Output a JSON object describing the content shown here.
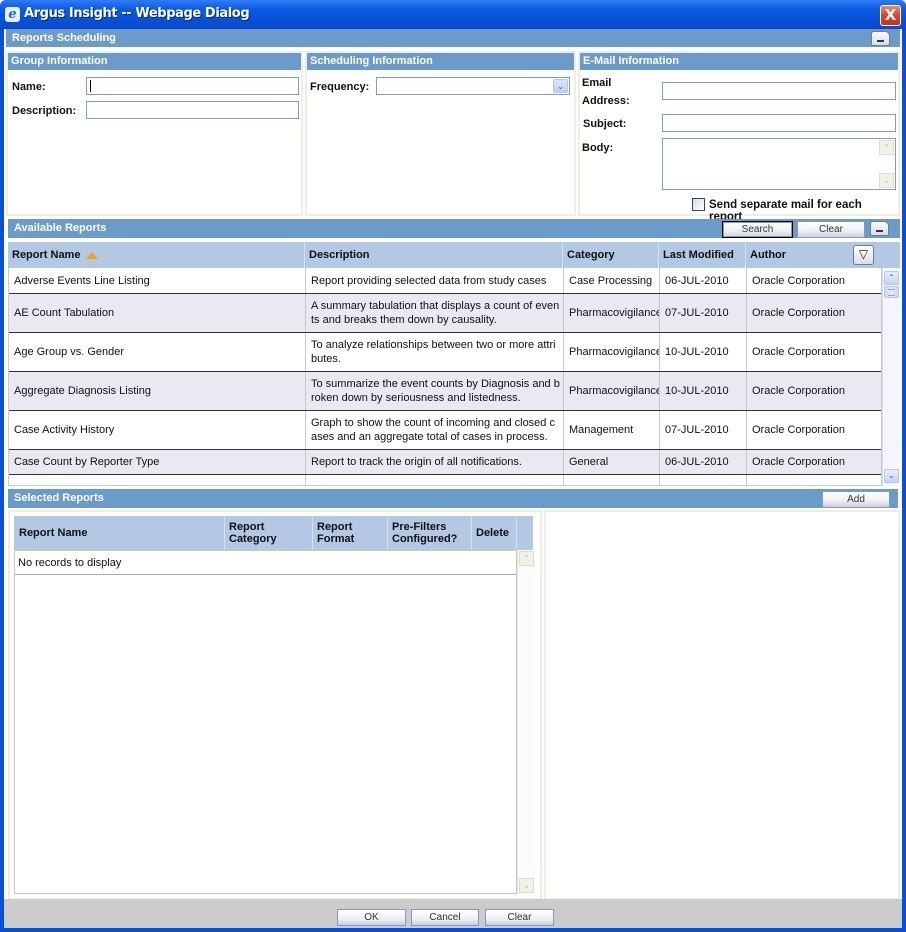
{
  "window": {
    "title": "Argus Insight -- Webpage Dialog",
    "close_icon": "X"
  },
  "header": {
    "title": "Reports Scheduling"
  },
  "group_info": {
    "title": "Group Information",
    "name_label": "Name:",
    "name_value": "",
    "description_label": "Description:",
    "description_value": ""
  },
  "scheduling_info": {
    "title": "Scheduling Information",
    "frequency_label": "Frequency:",
    "frequency_value": "",
    "dropdown_icon": "⌄"
  },
  "email_info": {
    "title": "E-Mail Information",
    "email_label_line1": "Email",
    "email_label_line2": "Address:",
    "email_value": "",
    "subject_label": "Subject:",
    "subject_value": "",
    "body_label": "Body:",
    "body_value": "",
    "separate_mail_label": "Send separate mail for each report",
    "separate_mail_checked": false
  },
  "available_reports": {
    "title": "Available Reports",
    "search_label": "Search",
    "clear_label": "Clear",
    "columns": [
      "Report Name",
      "Description",
      "Category",
      "Last Modified",
      "Author"
    ],
    "sort_column": "Report Name",
    "sort_direction": "ascending",
    "filter_icon": "▽",
    "rows": [
      {
        "name": "Adverse Events Line Listing",
        "description": "Report providing selected data from study cases",
        "category": "Case Processing",
        "modified": "06-JUL-2010",
        "author": "Oracle Corporation"
      },
      {
        "name": "AE Count Tabulation",
        "description": "A summary tabulation that displays a count of even ts and breaks them down by causality.",
        "category": "Pharmacovigilance",
        "modified": "07-JUL-2010",
        "author": "Oracle Corporation"
      },
      {
        "name": "Age Group vs. Gender",
        "description": "To analyze relationships between two or more attri butes.",
        "category": "Pharmacovigilance",
        "modified": "10-JUL-2010",
        "author": "Oracle Corporation"
      },
      {
        "name": "Aggregate Diagnosis Listing",
        "description": "To summarize the event counts by Diagnosis and b roken down by seriousness and listedness.",
        "category": "Pharmacovigilance",
        "modified": "10-JUL-2010",
        "author": "Oracle Corporation"
      },
      {
        "name": "Case Activity History",
        "description": "Graph to show the count of incoming and closed c ases and an aggregate total of cases in process.",
        "category": "Management",
        "modified": "07-JUL-2010",
        "author": "Oracle Corporation"
      },
      {
        "name": "Case Count by Reporter Type",
        "description": "Report to track the origin of all notifications.",
        "category": "General",
        "modified": "06-JUL-2010",
        "author": "Oracle Corporation"
      }
    ]
  },
  "selected_reports": {
    "title": "Selected Reports",
    "add_label": "Add",
    "columns": [
      {
        "line1": "Report Name",
        "line2": ""
      },
      {
        "line1": "Report",
        "line2": "Category"
      },
      {
        "line1": "Report",
        "line2": "Format"
      },
      {
        "line1": "Pre-Filters",
        "line2": "Configured?"
      },
      {
        "line1": "Delete",
        "line2": ""
      }
    ],
    "empty_message": "No records to display"
  },
  "footer": {
    "ok_label": "OK",
    "cancel_label": "Cancel",
    "clear_label": "Clear"
  }
}
